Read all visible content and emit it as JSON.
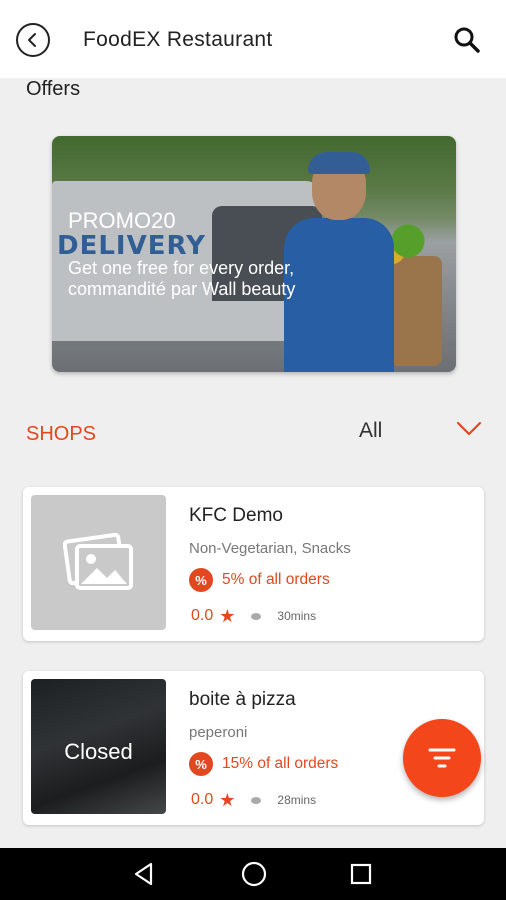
{
  "appbar": {
    "title": "FoodEX Restaurant",
    "back_icon": "back-arrow-icon",
    "search_icon": "search-icon"
  },
  "offers": {
    "label": "Offers",
    "banner": {
      "code": "PROMO20",
      "description": "Get one free for every order, commandité par Wall beauty"
    }
  },
  "shops": {
    "label": "SHOPS",
    "filter": "All",
    "items": [
      {
        "name": "KFC Demo",
        "category": "Non-Vegetarian, Snacks",
        "offer": "5% of all orders",
        "offer_badge": "%",
        "rating": "0.0",
        "time": "30mins",
        "status": ""
      },
      {
        "name": "boite à pizza",
        "category": "peperoni",
        "offer": "15% of all orders",
        "offer_badge": "%",
        "rating": "0.0",
        "time": "28mins",
        "status": "Closed"
      }
    ]
  },
  "colors": {
    "accent": "#e2481f",
    "fab": "#f3461a"
  }
}
